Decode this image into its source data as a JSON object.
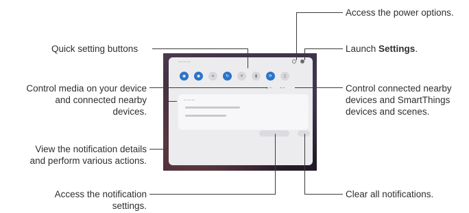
{
  "callouts": {
    "power": "Access the power options.",
    "settings_prefix": "Launch ",
    "settings_bold": "Settings",
    "settings_suffix": ".",
    "quick": "Quick setting buttons",
    "media_l1": "Control media on your device",
    "media_l2": "and connected nearby",
    "media_l3": "devices.",
    "devices_l1": "Control connected nearby",
    "devices_l2": "devices and SmartThings",
    "devices_l3": "devices and scenes.",
    "details_l1": "View the notification details",
    "details_l2": "and perform various actions.",
    "notif_settings_l1": "Access the notification",
    "notif_settings_l2": "settings.",
    "clear": "Clear all notifications."
  },
  "quick_buttons": [
    {
      "icon": "wifi-icon",
      "glyph": "◉",
      "on": true
    },
    {
      "icon": "sound-icon",
      "glyph": "◉",
      "on": true
    },
    {
      "icon": "bluetooth-icon",
      "glyph": "∗",
      "on": false
    },
    {
      "icon": "rotate-icon",
      "glyph": "↻",
      "on": true
    },
    {
      "icon": "airplane-icon",
      "glyph": "✈",
      "on": false
    },
    {
      "icon": "flashlight-icon",
      "glyph": "▮",
      "on": false
    },
    {
      "icon": "sync-icon",
      "glyph": "⟳",
      "on": true
    },
    {
      "icon": "battery-icon",
      "glyph": "▯",
      "on": false
    }
  ]
}
